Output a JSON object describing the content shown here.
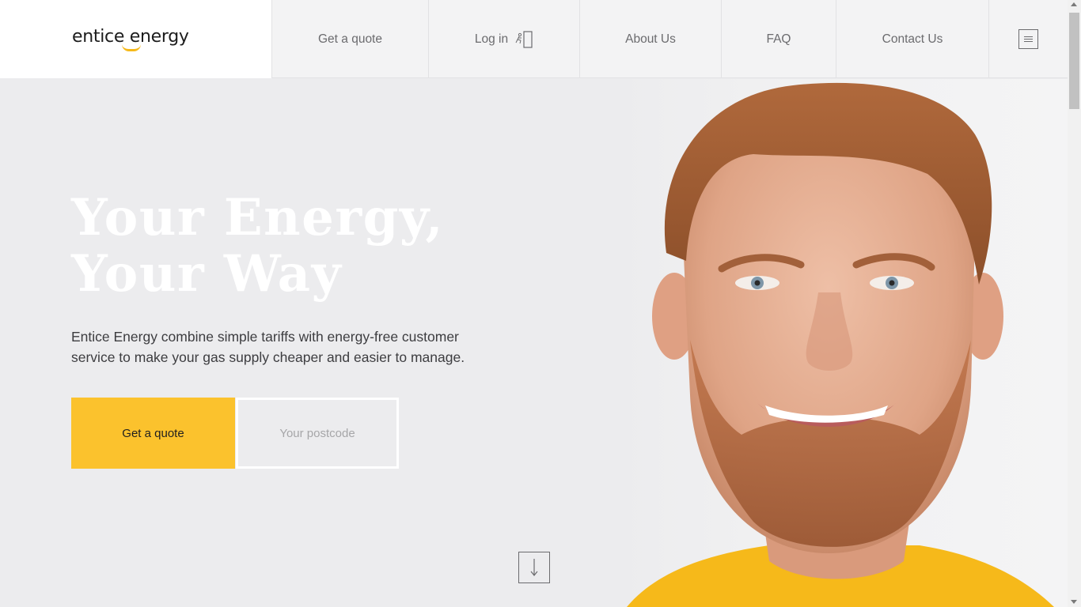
{
  "brand": {
    "logo_text": "entice energy",
    "accent": "#fbc22d"
  },
  "nav": {
    "quote": "Get a quote",
    "login": "Log in",
    "about": "About Us",
    "faq": "FAQ",
    "contact": "Contact Us"
  },
  "hero": {
    "title_line1": "Your Energy,",
    "title_line2": "Your Way",
    "description": "Entice Energy combine simple tariffs with energy-free customer service to make your gas supply cheaper and easier to manage.",
    "cta_label": "Get a quote",
    "postcode_placeholder": "Your postcode"
  },
  "icons": [
    "login-icon",
    "menu-icon",
    "down-arrow-icon"
  ]
}
